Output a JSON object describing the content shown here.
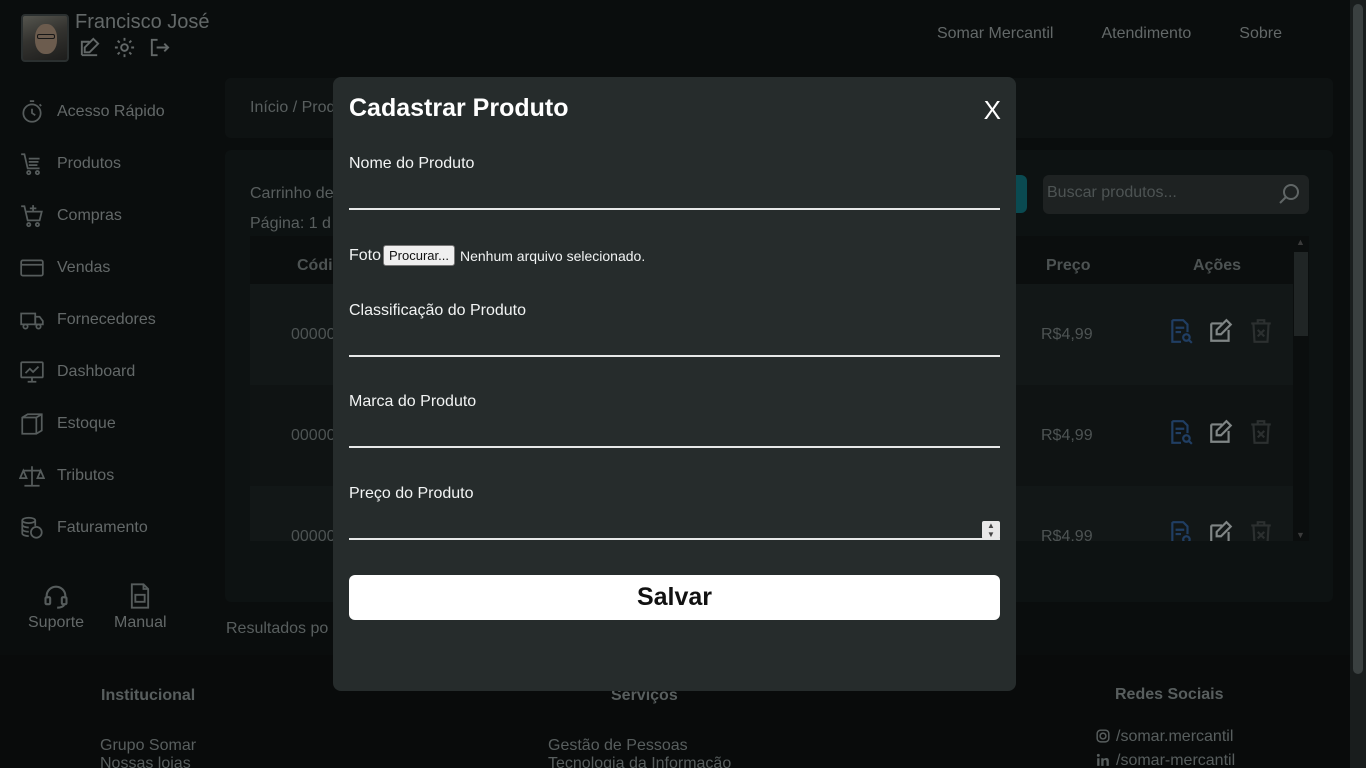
{
  "user": {
    "name": "Francisco José"
  },
  "topnav": [
    {
      "label": "Somar Mercantil"
    },
    {
      "label": "Atendimento"
    },
    {
      "label": "Sobre"
    }
  ],
  "sidebar": {
    "items": [
      {
        "label": "Acesso Rápido",
        "icon": "stopwatch-icon"
      },
      {
        "label": "Produtos",
        "icon": "cart-list-icon"
      },
      {
        "label": "Compras",
        "icon": "cart-plus-icon"
      },
      {
        "label": "Vendas",
        "icon": "card-icon"
      },
      {
        "label": "Fornecedores",
        "icon": "truck-icon"
      },
      {
        "label": "Dashboard",
        "icon": "monitor-icon"
      },
      {
        "label": "Estoque",
        "icon": "box-icon"
      },
      {
        "label": "Tributos",
        "icon": "scale-icon"
      },
      {
        "label": "Faturamento",
        "icon": "coins-icon"
      }
    ],
    "support_label": "Suporte",
    "manual_label": "Manual"
  },
  "main": {
    "breadcrumb": "Início / Prod",
    "cart_text": "Carrinho de",
    "page_text": "Página: 1 d",
    "search_placeholder": "Buscar produtos...",
    "table": {
      "headers": {
        "code": "Códi",
        "price": "Preço",
        "actions": "Ações"
      },
      "rows": [
        {
          "code": "00000",
          "price": "R$4,99"
        },
        {
          "code": "00000",
          "price": "R$4,99"
        },
        {
          "code": "00000",
          "price": "R$4,99"
        }
      ]
    },
    "results_text": "Resultados po"
  },
  "footer": {
    "institutional": {
      "title": "Institucional",
      "links": [
        "Grupo Somar",
        "Nossas lojas"
      ]
    },
    "services": {
      "title": "Serviços",
      "links": [
        "Gestão de Pessoas",
        "Tecnologia da Informação"
      ]
    },
    "social": {
      "title": "Redes Sociais",
      "links": [
        "/somar.mercantil",
        "/somar-mercantil"
      ]
    }
  },
  "modal": {
    "title": "Cadastrar Produto",
    "close_label": "X",
    "name_label": "Nome do Produto",
    "photo_label": "Foto",
    "browse_label": "Procurar...",
    "no_file_label": "Nenhum arquivo selecionado.",
    "class_label": "Classificação do Produto",
    "brand_label": "Marca do Produto",
    "price_label": "Preço do Produto",
    "save_label": "Salvar"
  },
  "colors": {
    "accent": "#0f6b74",
    "view_icon": "#2f5a8e",
    "delete_icon": "#3f4646"
  }
}
